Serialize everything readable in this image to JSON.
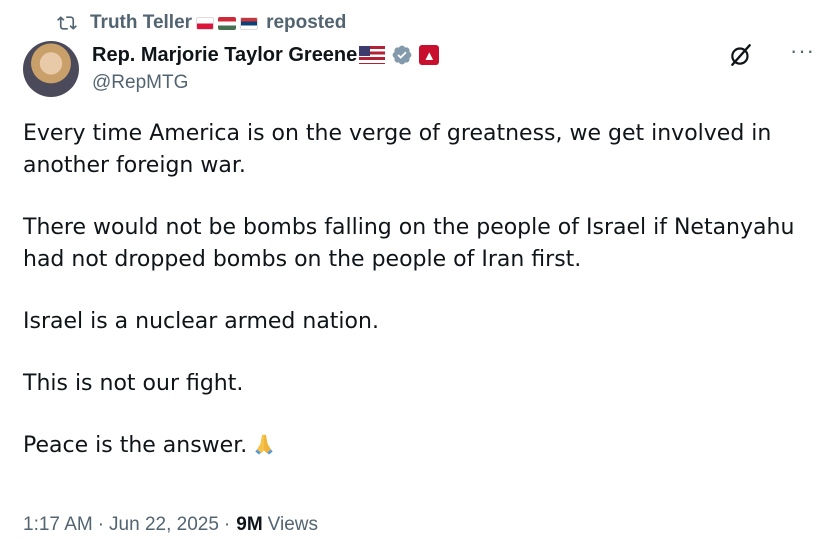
{
  "repost": {
    "icon": "repost-icon",
    "reposter_name": "Truth Teller",
    "flags": [
      "poland-flag",
      "hungary-flag",
      "serbia-flag"
    ],
    "label": "reposted"
  },
  "author": {
    "name": "Rep. Marjorie Taylor Greene",
    "handle": "@RepMTG",
    "badges": [
      "us-flag",
      "verified-badge-icon",
      "government-badge-icon"
    ]
  },
  "post": {
    "paragraphs": [
      "Every time America is on the verge of greatness, we get involved in another foreign war.",
      "There would not be bombs falling on the people of Israel if Netanyahu had not dropped bombs on the people of Iran first.",
      "Israel is a nuclear armed nation.",
      "This is not our fight.",
      "Peace is the answer."
    ],
    "emoji": "folded-hands-icon"
  },
  "meta": {
    "time": "1:17 AM",
    "separator": "·",
    "date": "Jun 22, 2025",
    "views_count": "9M",
    "views_label": "Views"
  },
  "colors": {
    "text_primary": "#0f1419",
    "text_secondary": "#536471",
    "verified_badge": "#829aab"
  }
}
